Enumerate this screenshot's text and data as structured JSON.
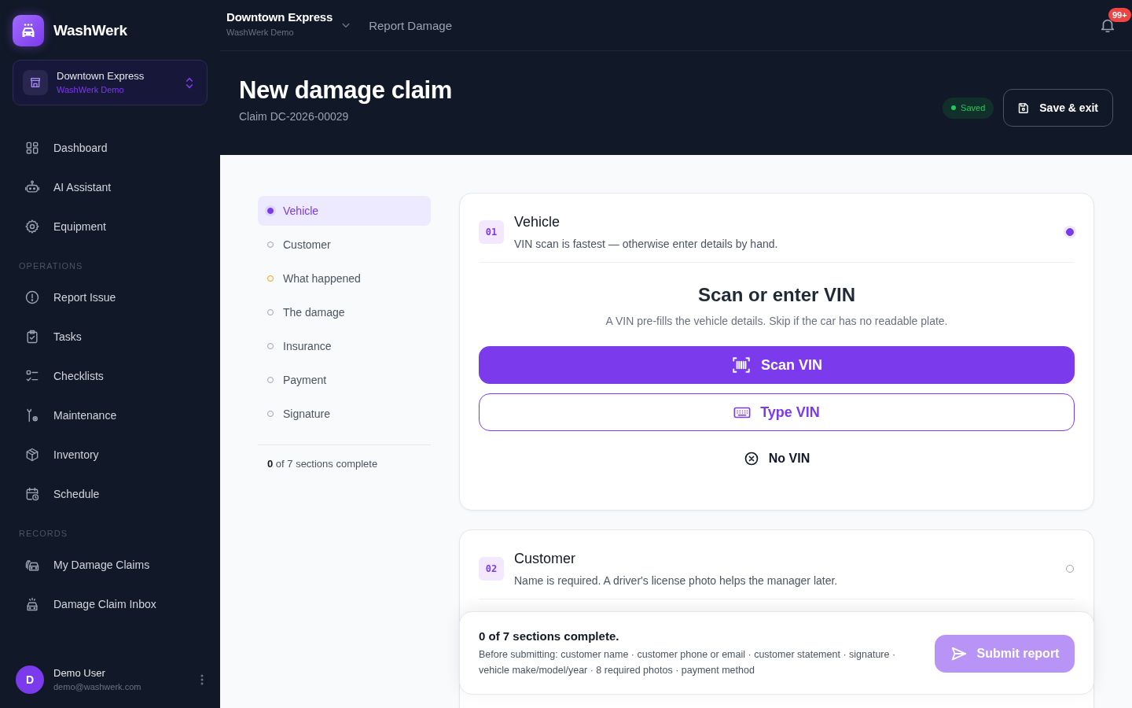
{
  "sidebar": {
    "brand": "WashWerk",
    "switcher": {
      "name": "Downtown Express",
      "org": "WashWerk Demo"
    },
    "sections": [
      {
        "items": [
          {
            "label": "Dashboard",
            "selected": false
          },
          {
            "label": "AI Assistant",
            "selected": false
          },
          {
            "label": "Equipment",
            "selected": false
          }
        ]
      },
      {
        "heading": "OPERATIONS",
        "items": [
          {
            "label": "Report Issue",
            "selected": false
          },
          {
            "label": "Tasks",
            "selected": false
          },
          {
            "label": "Checklists",
            "selected": false
          },
          {
            "label": "Maintenance",
            "selected": false
          },
          {
            "label": "Inventory",
            "selected": false
          },
          {
            "label": "Schedule",
            "selected": false
          }
        ]
      },
      {
        "heading": "RECORDS",
        "items": [
          {
            "label": "My Damage Claims",
            "selected": false
          },
          {
            "label": "Damage Claim Inbox",
            "selected": false
          }
        ]
      }
    ],
    "user": {
      "initial": "D",
      "name": "Demo User",
      "email": "demo@washwerk.com"
    }
  },
  "topbar": {
    "location": "Downtown Express",
    "org": "WashWerk Demo",
    "page": "Report Damage",
    "notifications": "99+"
  },
  "header": {
    "title": "New damage claim",
    "claim": "Claim DC-2026-00029",
    "status": "Saved",
    "save_button": "Save & exit"
  },
  "steps": {
    "items": [
      {
        "label": "Vehicle",
        "selected": true,
        "flagged": false
      },
      {
        "label": "Customer",
        "selected": false,
        "flagged": false
      },
      {
        "label": "What happened",
        "selected": false,
        "flagged": true
      },
      {
        "label": "The damage",
        "selected": false,
        "flagged": false
      },
      {
        "label": "Insurance",
        "selected": false,
        "flagged": false
      },
      {
        "label": "Payment",
        "selected": false,
        "flagged": false
      },
      {
        "label": "Signature",
        "selected": false,
        "flagged": false
      }
    ],
    "progress": "**0** of 7 sections complete"
  },
  "sections": [
    {
      "number": "01",
      "title": "Vehicle",
      "subtitle": "VIN scan is fastest — otherwise enter details by hand.",
      "selected": true,
      "vin": {
        "heading": "Scan or enter VIN",
        "text": "A VIN pre-fills the vehicle details. Skip if the car has no readable plate.",
        "scan": "Scan VIN",
        "type": "Type VIN",
        "skip": "No VIN"
      }
    },
    {
      "number": "02",
      "title": "Customer",
      "subtitle": "Name is required. A driver's license photo helps the manager later.",
      "selected": false
    }
  ],
  "submit_bar": {
    "title": "0 of 7 sections complete.",
    "requirements": "Before submitting: customer name · customer phone or email · customer statement · signature · vehicle make/model/year · 8 required photos · payment method",
    "button": "Submit report",
    "disabled": true
  }
}
